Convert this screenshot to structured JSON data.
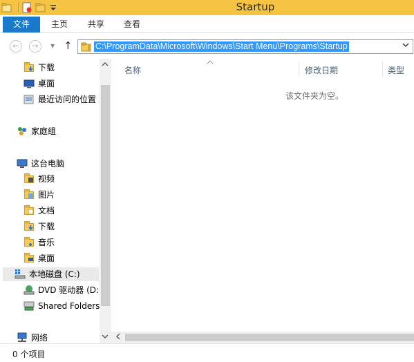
{
  "window": {
    "title": "Startup"
  },
  "ribbon": {
    "file_tab": "文件",
    "tabs": [
      "主页",
      "共享",
      "查看"
    ]
  },
  "address": {
    "path": "C:\\ProgramData\\Microsoft\\Windows\\Start Menu\\Programs\\Startup"
  },
  "nav": {
    "items": [
      {
        "label": "下载",
        "icon": "downloads-folder-icon"
      },
      {
        "label": "桌面",
        "icon": "desktop-icon"
      },
      {
        "label": "最近访问的位置",
        "icon": "recent-places-icon"
      },
      {
        "label": "家庭组",
        "icon": "homegroup-icon"
      },
      {
        "label": "这台电脑",
        "icon": "this-pc-icon"
      },
      {
        "label": "视频",
        "icon": "videos-folder-icon"
      },
      {
        "label": "图片",
        "icon": "pictures-folder-icon"
      },
      {
        "label": "文档",
        "icon": "documents-folder-icon"
      },
      {
        "label": "下载",
        "icon": "downloads-folder-icon"
      },
      {
        "label": "音乐",
        "icon": "music-folder-icon"
      },
      {
        "label": "桌面",
        "icon": "desktop-folder-icon"
      },
      {
        "label": "本地磁盘 (C:)",
        "icon": "local-disk-icon"
      },
      {
        "label": "DVD 驱动器 (D:)",
        "icon": "dvd-drive-icon"
      },
      {
        "label": "Shared Folders",
        "icon": "shared-folders-icon"
      },
      {
        "label": "网络",
        "icon": "network-icon"
      }
    ]
  },
  "content": {
    "columns": [
      "名称",
      "修改日期",
      "类型"
    ],
    "empty_message": "该文件夹为空。"
  },
  "status": {
    "item_count": "0 个项目"
  },
  "colors": {
    "titlebar": "#f6c343",
    "file_tab": "#1979ca",
    "selection": "#3399ff"
  }
}
